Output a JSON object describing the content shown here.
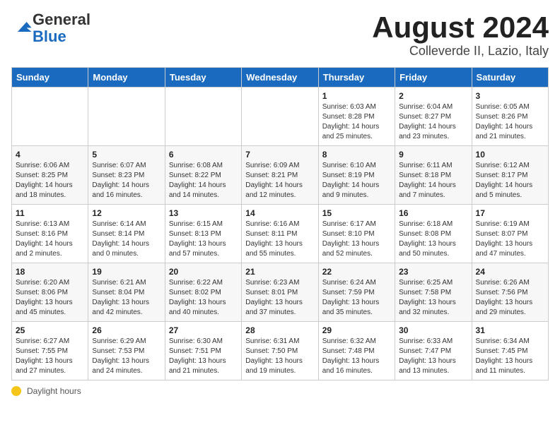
{
  "header": {
    "logo": {
      "line1": "General",
      "line2": "Blue"
    },
    "title": "August 2024",
    "location": "Colleverde II, Lazio, Italy"
  },
  "weekdays": [
    "Sunday",
    "Monday",
    "Tuesday",
    "Wednesday",
    "Thursday",
    "Friday",
    "Saturday"
  ],
  "weeks": [
    [
      {
        "day": "",
        "info": ""
      },
      {
        "day": "",
        "info": ""
      },
      {
        "day": "",
        "info": ""
      },
      {
        "day": "",
        "info": ""
      },
      {
        "day": "1",
        "info": "Sunrise: 6:03 AM\nSunset: 8:28 PM\nDaylight: 14 hours and 25 minutes."
      },
      {
        "day": "2",
        "info": "Sunrise: 6:04 AM\nSunset: 8:27 PM\nDaylight: 14 hours and 23 minutes."
      },
      {
        "day": "3",
        "info": "Sunrise: 6:05 AM\nSunset: 8:26 PM\nDaylight: 14 hours and 21 minutes."
      }
    ],
    [
      {
        "day": "4",
        "info": "Sunrise: 6:06 AM\nSunset: 8:25 PM\nDaylight: 14 hours and 18 minutes."
      },
      {
        "day": "5",
        "info": "Sunrise: 6:07 AM\nSunset: 8:23 PM\nDaylight: 14 hours and 16 minutes."
      },
      {
        "day": "6",
        "info": "Sunrise: 6:08 AM\nSunset: 8:22 PM\nDaylight: 14 hours and 14 minutes."
      },
      {
        "day": "7",
        "info": "Sunrise: 6:09 AM\nSunset: 8:21 PM\nDaylight: 14 hours and 12 minutes."
      },
      {
        "day": "8",
        "info": "Sunrise: 6:10 AM\nSunset: 8:19 PM\nDaylight: 14 hours and 9 minutes."
      },
      {
        "day": "9",
        "info": "Sunrise: 6:11 AM\nSunset: 8:18 PM\nDaylight: 14 hours and 7 minutes."
      },
      {
        "day": "10",
        "info": "Sunrise: 6:12 AM\nSunset: 8:17 PM\nDaylight: 14 hours and 5 minutes."
      }
    ],
    [
      {
        "day": "11",
        "info": "Sunrise: 6:13 AM\nSunset: 8:16 PM\nDaylight: 14 hours and 2 minutes."
      },
      {
        "day": "12",
        "info": "Sunrise: 6:14 AM\nSunset: 8:14 PM\nDaylight: 14 hours and 0 minutes."
      },
      {
        "day": "13",
        "info": "Sunrise: 6:15 AM\nSunset: 8:13 PM\nDaylight: 13 hours and 57 minutes."
      },
      {
        "day": "14",
        "info": "Sunrise: 6:16 AM\nSunset: 8:11 PM\nDaylight: 13 hours and 55 minutes."
      },
      {
        "day": "15",
        "info": "Sunrise: 6:17 AM\nSunset: 8:10 PM\nDaylight: 13 hours and 52 minutes."
      },
      {
        "day": "16",
        "info": "Sunrise: 6:18 AM\nSunset: 8:08 PM\nDaylight: 13 hours and 50 minutes."
      },
      {
        "day": "17",
        "info": "Sunrise: 6:19 AM\nSunset: 8:07 PM\nDaylight: 13 hours and 47 minutes."
      }
    ],
    [
      {
        "day": "18",
        "info": "Sunrise: 6:20 AM\nSunset: 8:06 PM\nDaylight: 13 hours and 45 minutes."
      },
      {
        "day": "19",
        "info": "Sunrise: 6:21 AM\nSunset: 8:04 PM\nDaylight: 13 hours and 42 minutes."
      },
      {
        "day": "20",
        "info": "Sunrise: 6:22 AM\nSunset: 8:02 PM\nDaylight: 13 hours and 40 minutes."
      },
      {
        "day": "21",
        "info": "Sunrise: 6:23 AM\nSunset: 8:01 PM\nDaylight: 13 hours and 37 minutes."
      },
      {
        "day": "22",
        "info": "Sunrise: 6:24 AM\nSunset: 7:59 PM\nDaylight: 13 hours and 35 minutes."
      },
      {
        "day": "23",
        "info": "Sunrise: 6:25 AM\nSunset: 7:58 PM\nDaylight: 13 hours and 32 minutes."
      },
      {
        "day": "24",
        "info": "Sunrise: 6:26 AM\nSunset: 7:56 PM\nDaylight: 13 hours and 29 minutes."
      }
    ],
    [
      {
        "day": "25",
        "info": "Sunrise: 6:27 AM\nSunset: 7:55 PM\nDaylight: 13 hours and 27 minutes."
      },
      {
        "day": "26",
        "info": "Sunrise: 6:29 AM\nSunset: 7:53 PM\nDaylight: 13 hours and 24 minutes."
      },
      {
        "day": "27",
        "info": "Sunrise: 6:30 AM\nSunset: 7:51 PM\nDaylight: 13 hours and 21 minutes."
      },
      {
        "day": "28",
        "info": "Sunrise: 6:31 AM\nSunset: 7:50 PM\nDaylight: 13 hours and 19 minutes."
      },
      {
        "day": "29",
        "info": "Sunrise: 6:32 AM\nSunset: 7:48 PM\nDaylight: 13 hours and 16 minutes."
      },
      {
        "day": "30",
        "info": "Sunrise: 6:33 AM\nSunset: 7:47 PM\nDaylight: 13 hours and 13 minutes."
      },
      {
        "day": "31",
        "info": "Sunrise: 6:34 AM\nSunset: 7:45 PM\nDaylight: 13 hours and 11 minutes."
      }
    ]
  ],
  "footer": {
    "note": "Daylight hours"
  }
}
